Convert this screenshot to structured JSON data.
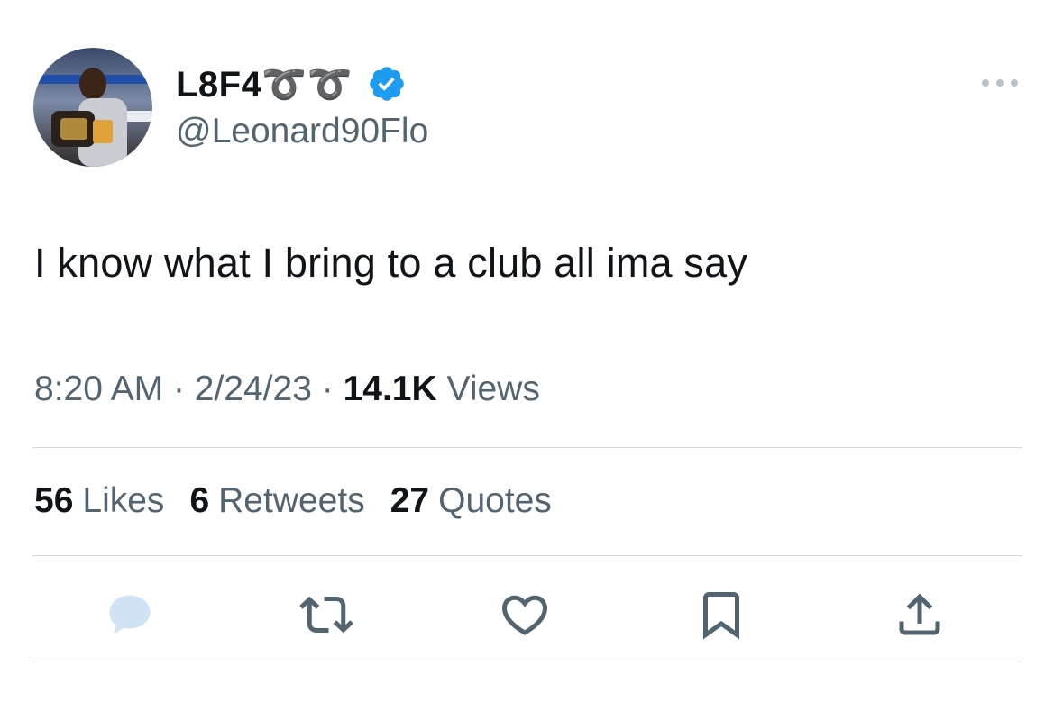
{
  "user": {
    "display_name": "L8F4➰➰",
    "handle": "@Leonard90Flo",
    "verified": true,
    "avatar": "profile-photo"
  },
  "tweet": {
    "text": "I know what I bring to a club all ima say"
  },
  "meta": {
    "time": "8:20 AM",
    "date": "2/24/23",
    "separator": "·",
    "views_count": "14.1K",
    "views_label": "Views"
  },
  "stats": {
    "likes_count": "56",
    "likes_label": "Likes",
    "retweets_count": "6",
    "retweets_label": "Retweets",
    "quotes_count": "27",
    "quotes_label": "Quotes"
  },
  "actions": [
    {
      "icon": "reply-icon"
    },
    {
      "icon": "retweet-icon"
    },
    {
      "icon": "like-icon"
    },
    {
      "icon": "bookmark-icon"
    },
    {
      "icon": "share-icon"
    }
  ],
  "colors": {
    "text_primary": "#0f1419",
    "text_secondary": "#536471",
    "divider": "#cfd9de",
    "verified_blue": "#1d9bf0"
  }
}
